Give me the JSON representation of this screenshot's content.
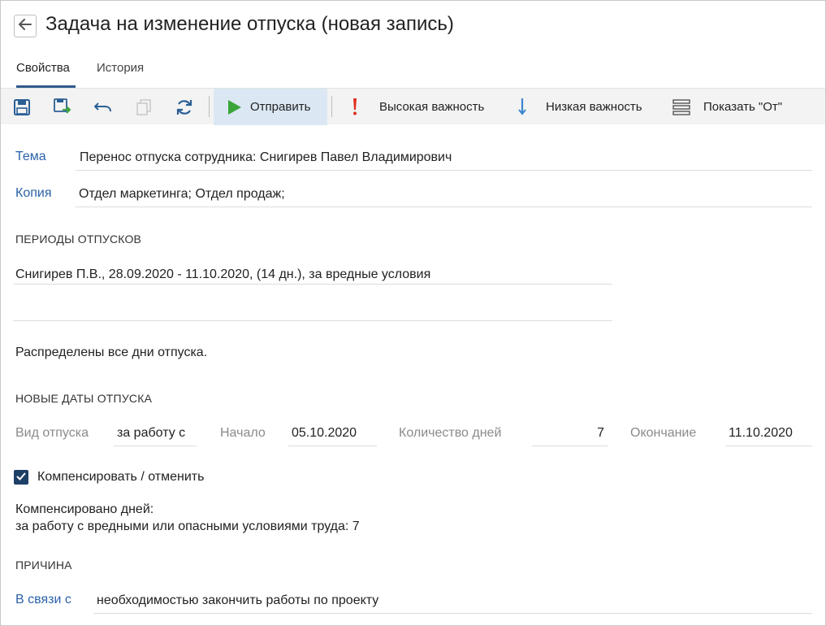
{
  "header": {
    "title": "Задача на изменение отпуска (новая запись)"
  },
  "tabs": [
    {
      "label": "Свойства",
      "active": true
    },
    {
      "label": "История",
      "active": false
    }
  ],
  "toolbar": {
    "send_label": "Отправить",
    "high_importance_label": "Высокая важность",
    "low_importance_label": "Низкая важность",
    "show_from_label": "Показать \"От\""
  },
  "form": {
    "subject_label": "Тема",
    "subject_value": "Перенос отпуска сотрудника: Снигирев Павел Владимирович",
    "copy_label": "Копия",
    "copy_value": "Отдел маркетинга;  Отдел продаж;",
    "periods_heading": "ПЕРИОДЫ ОТПУСКОВ",
    "period_entry": "Снигирев П.В., 28.09.2020 - 11.10.2020, (14 дн.), за вредные условия",
    "distributed_text": "Распределены все дни отпуска.",
    "new_dates_heading": "НОВЫЕ ДАТЫ ОТПУСКА",
    "vacation_type_label": "Вид отпуска",
    "vacation_type_value": "за работу с",
    "start_label": "Начало",
    "start_value": "05.10.2020",
    "days_label": "Количество дней",
    "days_value": "7",
    "end_label": "Окончание",
    "end_value": "11.10.2020",
    "compensate_label": "Компенсировать / отменить",
    "compensate_checked": true,
    "compensated_days_label": "Компенсировано дней:",
    "compensated_detail": "за работу с вредными или опасными условиями труда: 7",
    "reason_heading": "ПРИЧИНА",
    "reason_label": "В связи с",
    "reason_value": "необходимостью закончить работы по проекту"
  },
  "colors": {
    "accent": "#2f5b8c",
    "link_label": "#2b62a8",
    "send_green": "#3aa63a",
    "high_importance_red": "#e0301e",
    "low_importance_blue": "#3a86d0"
  }
}
